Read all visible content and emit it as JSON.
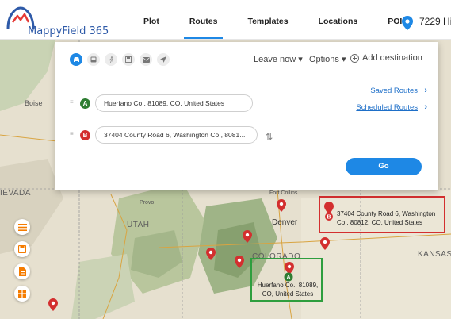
{
  "app": {
    "title": "MappyField 365"
  },
  "nav": {
    "items": [
      {
        "label": "Plot",
        "active": false
      },
      {
        "label": "Routes",
        "active": true
      },
      {
        "label": "Templates",
        "active": false
      },
      {
        "label": "Locations",
        "active": false
      },
      {
        "label": "POI",
        "active": false
      }
    ],
    "location_text": "7229 Hi"
  },
  "routes_panel": {
    "travel_modes": [
      {
        "icon": "car-icon",
        "active": true
      },
      {
        "icon": "bus-icon",
        "active": false
      },
      {
        "icon": "walk-icon",
        "active": false
      },
      {
        "icon": "save-icon",
        "active": false
      },
      {
        "icon": "mail-icon",
        "active": false
      },
      {
        "icon": "navigate-icon",
        "active": false
      }
    ],
    "leave_now_label": "Leave now",
    "options_label": "Options",
    "add_destination_label": "Add destination",
    "origin": {
      "marker": "A",
      "value": "Huerfano Co., 81089, CO, United States"
    },
    "destination": {
      "marker": "B",
      "value": "37404 County Road 6, Washington Co., 8081..."
    },
    "saved_routes_label": "Saved Routes",
    "scheduled_routes_label": "Scheduled Routes",
    "go_label": "Go"
  },
  "map": {
    "labels": {
      "boise": "Boise",
      "nevada": "IEVADA",
      "provo": "Provo",
      "utah": "UTAH",
      "fort_collins": "Fort Collins",
      "denver": "Denver",
      "colorado": "COLORADO",
      "kansas": "KANSAS"
    },
    "destination_popup": "37404 County Road 6, Washington Co., 80812, CO, United States",
    "origin_popup": "Huerfano Co., 81089, CO, United States",
    "colors": {
      "accent": "#1e88e5",
      "pin": "#d32f2f",
      "origin": "#2e7d32",
      "rail": "#f57c00"
    }
  },
  "rail": {
    "buttons": [
      {
        "icon": "list-icon"
      },
      {
        "icon": "save-icon"
      },
      {
        "icon": "document-icon"
      },
      {
        "icon": "grid-icon"
      }
    ]
  }
}
